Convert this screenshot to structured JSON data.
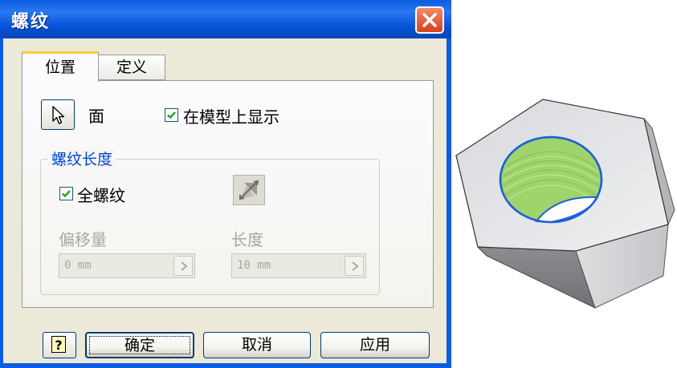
{
  "window": {
    "title": "螺纹"
  },
  "tabs": [
    {
      "label": "位置",
      "active": true
    },
    {
      "label": "定义",
      "active": false
    }
  ],
  "location": {
    "face_label": "面",
    "show_on_model": {
      "label": "在模型上显示",
      "checked": true
    }
  },
  "thread_length": {
    "group_title": "螺纹长度",
    "full_length": {
      "label": "全螺纹",
      "checked": true
    },
    "offset": {
      "label": "偏移量",
      "value": "0 mm",
      "enabled": false
    },
    "length": {
      "label": "长度",
      "value": "10 mm",
      "enabled": false
    }
  },
  "buttons": {
    "ok": "确定",
    "cancel": "取消",
    "apply": "应用"
  },
  "icons": {
    "close": "close-icon",
    "select": "cursor-arrow-icon",
    "direction": "flip-direction-icon",
    "help": "help-icon",
    "spin": "chevron-right-icon"
  },
  "colors": {
    "title_bar": "#0a5ce0",
    "group_title": "#0046d5",
    "thread_face": "#9fd36b",
    "nut_edge": "#1f5fd8"
  }
}
